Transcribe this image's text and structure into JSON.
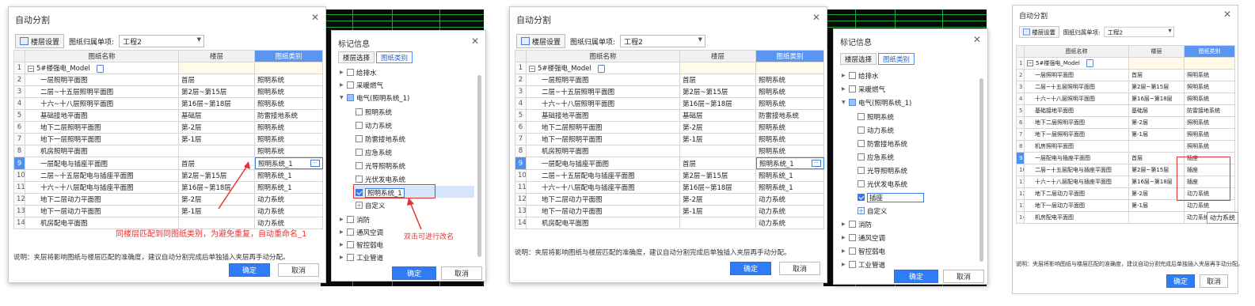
{
  "dialog": {
    "title": "自动分割",
    "close": "✕",
    "floor_settings_btn": "楼层设置",
    "belong_label": "图纸归属单项:",
    "belong_value": "工程2",
    "col_name": "图纸名称",
    "col_floor": "楼层",
    "col_cat": "图纸类别",
    "model_name": "5#楼强电_Model",
    "note": "说明：夹层将影响图纸与楼层匹配的准确度，建议自动分割完成后单独插入夹层再手动分配。",
    "ok": "确定",
    "cancel": "取消"
  },
  "rows": [
    {
      "no": "1"
    },
    {
      "no": "2",
      "name": "一层照明平面图",
      "floor": "首层",
      "cat": "照明系统"
    },
    {
      "no": "3",
      "name": "二层~十五层照明平面图",
      "floor": "第2层~第15层",
      "cat": "照明系统"
    },
    {
      "no": "4",
      "name": "十六~十八层照明平面图",
      "floor": "第16层~第18层",
      "cat": "照明系统"
    },
    {
      "no": "5",
      "name": "基础接地平面图",
      "floor": "基础层",
      "cat": "防雷接地系统"
    },
    {
      "no": "6",
      "name": "地下二层照明平面图",
      "floor": "第-2层",
      "cat": "照明系统"
    },
    {
      "no": "7",
      "name": "地下一层照明平面图",
      "floor": "第-1层",
      "cat": "照明系统"
    },
    {
      "no": "8",
      "name": "机房照明平面图",
      "floor": "",
      "cat": "照明系统"
    },
    {
      "no": "9",
      "name": "一层配电与插座平面图",
      "floor": "首层",
      "cat": "照明系统_1"
    },
    {
      "no": "10",
      "name": "二层~十五层配电与插座平面图",
      "floor": "第2层~第15层",
      "cat": "照明系统_1"
    },
    {
      "no": "11",
      "name": "十六~十八层配电与插座平面图",
      "floor": "第16层~第18层",
      "cat": "照明系统_1"
    },
    {
      "no": "12",
      "name": "地下二层动力平面图",
      "floor": "第-2层",
      "cat": "动力系统"
    },
    {
      "no": "13",
      "name": "地下一层动力平面图",
      "floor": "第-1层",
      "cat": "动力系统"
    },
    {
      "no": "14",
      "name": "机房配电平面图",
      "floor": "",
      "cat": "动力系统"
    }
  ],
  "panel3_cats": {
    "r9": "插座",
    "r10": "插座",
    "r11": "插座"
  },
  "mark": {
    "title": "标记信息",
    "close": "✕",
    "tab_floor": "楼层选择",
    "tab_cat": "图纸类别",
    "water": "给排水",
    "hvac_gas": "采暖燃气",
    "electric": "电气(照明系统_1)",
    "lighting": "照明系统",
    "power": "动力系统",
    "lightning": "防雷接地系统",
    "emergency": "应急系统",
    "guide": "光导照明系统",
    "pv": "光伏发电系统",
    "edit_value_1": "照明系统_1",
    "edit_value_2": "插座",
    "custom": "自定义",
    "fire": "消防",
    "ventilation": "通风空调",
    "smart": "智控弱电",
    "industrial": "工业管道",
    "ok": "确定",
    "cancel": "取消"
  },
  "annotations": {
    "rename_note": "同楼层匹配到同图纸类别，为避免重复，自动重命名_1",
    "dblclick_note": "双击可进行改名",
    "tooltip": "动力系统"
  }
}
